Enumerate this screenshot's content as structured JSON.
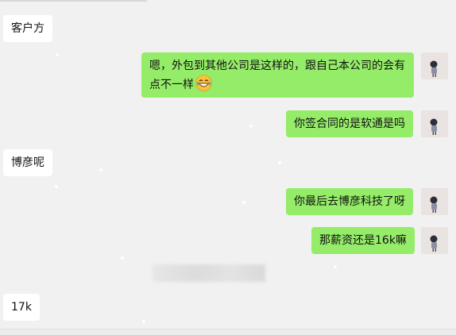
{
  "messages": [
    {
      "side": "left",
      "text": "客户方"
    },
    {
      "side": "right",
      "text": "嗯，外包到其他公司是这样的，跟自己本公司的会有点不一样",
      "emoji": "laughing-face"
    },
    {
      "side": "right",
      "text": "你签合同的是软通是吗"
    },
    {
      "side": "left",
      "text": "博彦呢"
    },
    {
      "side": "right",
      "text": "你最后去博彦科技了呀"
    },
    {
      "side": "right",
      "text": "那薪资还是16k嘛"
    },
    {
      "side": "left",
      "text": "17k"
    }
  ],
  "colors": {
    "background": "#f1f1f1",
    "left_bubble": "#ffffff",
    "right_bubble": "#95ec69"
  }
}
